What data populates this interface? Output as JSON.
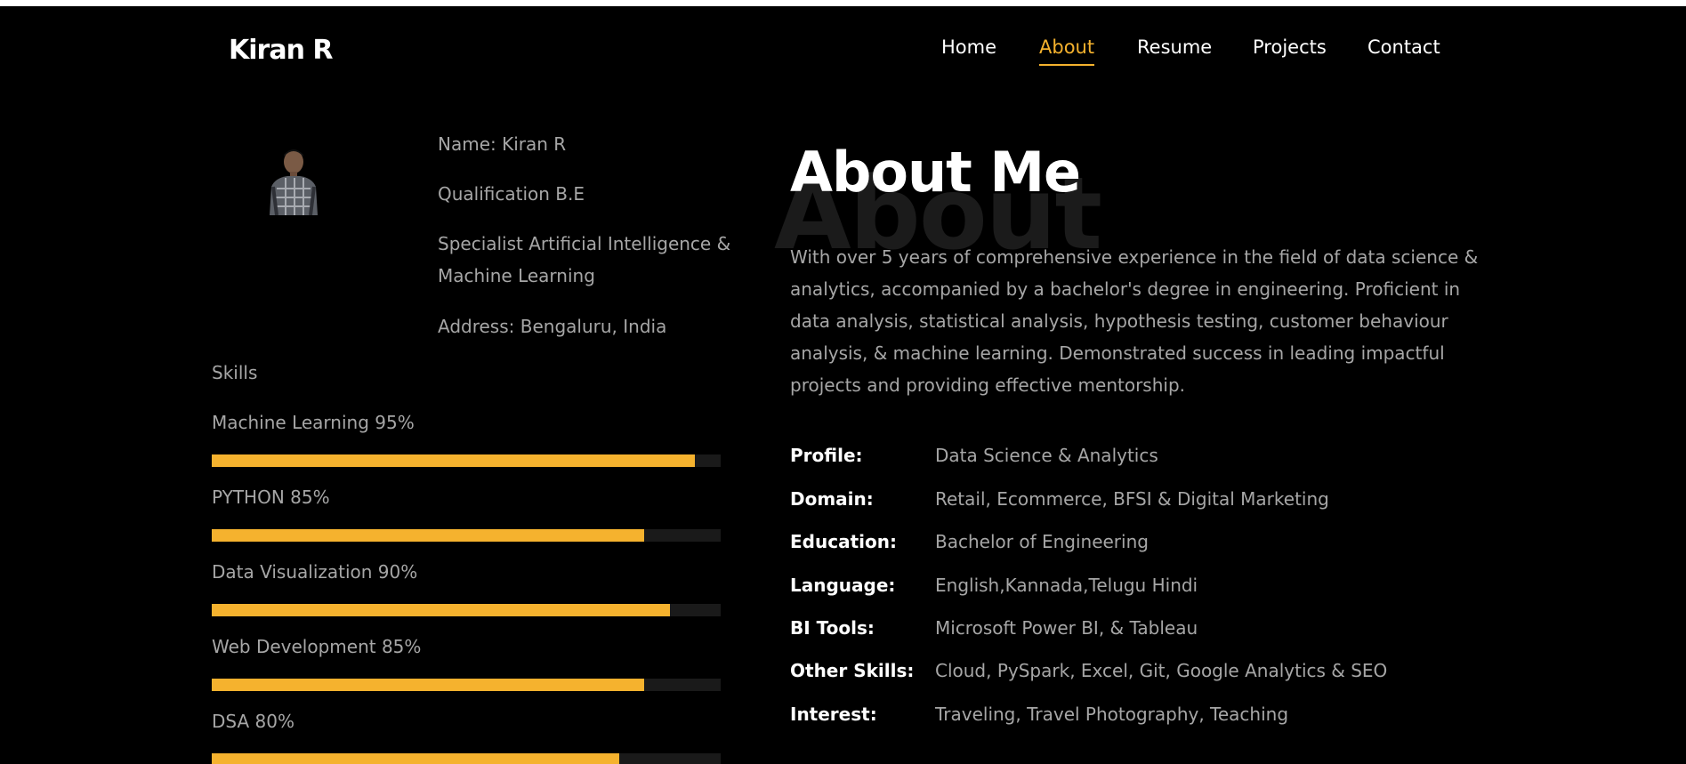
{
  "brand": "Kiran R",
  "nav": [
    {
      "label": "Home",
      "active": false
    },
    {
      "label": "About",
      "active": true
    },
    {
      "label": "Resume",
      "active": false
    },
    {
      "label": "Projects",
      "active": false
    },
    {
      "label": "Contact",
      "active": false
    }
  ],
  "info": {
    "name": "Name: Kiran R",
    "qualification": "Qualification B.E",
    "specialist": "Specialist Artificial Intelligence & Machine Learning",
    "address": "Address: Bengaluru, India"
  },
  "skills": {
    "title": "Skills",
    "items": [
      {
        "label": "Machine Learning 95%",
        "percent": 95
      },
      {
        "label": "PYTHON 85%",
        "percent": 85
      },
      {
        "label": "Data Visualization 90%",
        "percent": 90
      },
      {
        "label": "Web Development 85%",
        "percent": 85
      },
      {
        "label": "DSA 80%",
        "percent": 80
      }
    ]
  },
  "about": {
    "bg_word": "About",
    "title": "About Me",
    "description": "With over 5 years of comprehensive experience in the field of data science & analytics, accompanied by a bachelor's degree in engineering. Proficient in data analysis, statistical analysis, hypothesis testing, customer behaviour analysis, & machine learning. Demonstrated success in leading impactful projects and providing effective mentorship."
  },
  "details": [
    {
      "label": "Profile:",
      "value": "Data Science & Analytics"
    },
    {
      "label": "Domain:",
      "value": "Retail, Ecommerce, BFSI & Digital Marketing"
    },
    {
      "label": "Education:",
      "value": "Bachelor of Engineering"
    },
    {
      "label": "Language:",
      "value": "English,Kannada,Telugu Hindi"
    },
    {
      "label": "BI Tools:",
      "value": "Microsoft Power BI, & Tableau"
    },
    {
      "label": "Other Skills:",
      "value": "Cloud, PySpark, Excel, Git, Google Analytics & SEO"
    },
    {
      "label": "Interest:",
      "value": "Traveling, Travel Photography, Teaching"
    }
  ],
  "colors": {
    "accent": "#f5b22e",
    "background": "#000000",
    "muted_text": "#a6a6a6"
  }
}
